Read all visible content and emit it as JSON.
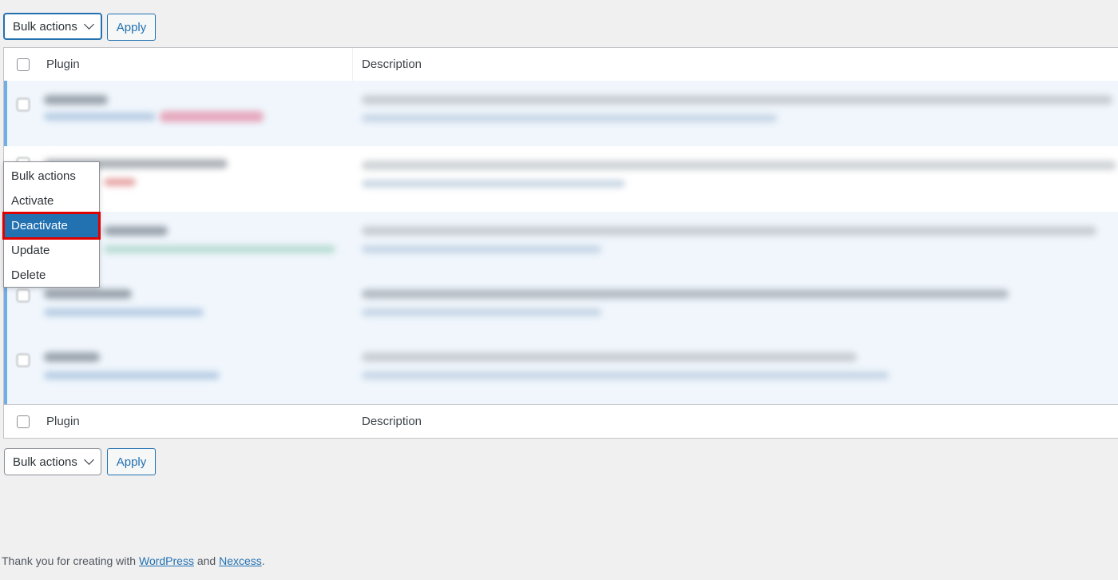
{
  "top_controls": {
    "bulk_label": "Bulk actions",
    "apply_label": "Apply"
  },
  "table": {
    "header": {
      "plugin": "Plugin",
      "description": "Description"
    },
    "footer": {
      "plugin": "Plugin",
      "description": "Description"
    }
  },
  "bulk_dropdown": {
    "options": [
      "Bulk actions",
      "Activate",
      "Deactivate",
      "Update",
      "Delete"
    ],
    "selected": "Deactivate"
  },
  "bottom_controls": {
    "bulk_label": "Bulk actions",
    "apply_label": "Apply"
  },
  "footer": {
    "prefix": "Thank you for creating with ",
    "wp_link": "WordPress",
    "middle": " and ",
    "nexcess_link": "Nexcess",
    "suffix": "."
  },
  "colors": {
    "accent": "#2271b1",
    "highlight": "#e00000",
    "active_row": "#f0f6fc"
  }
}
